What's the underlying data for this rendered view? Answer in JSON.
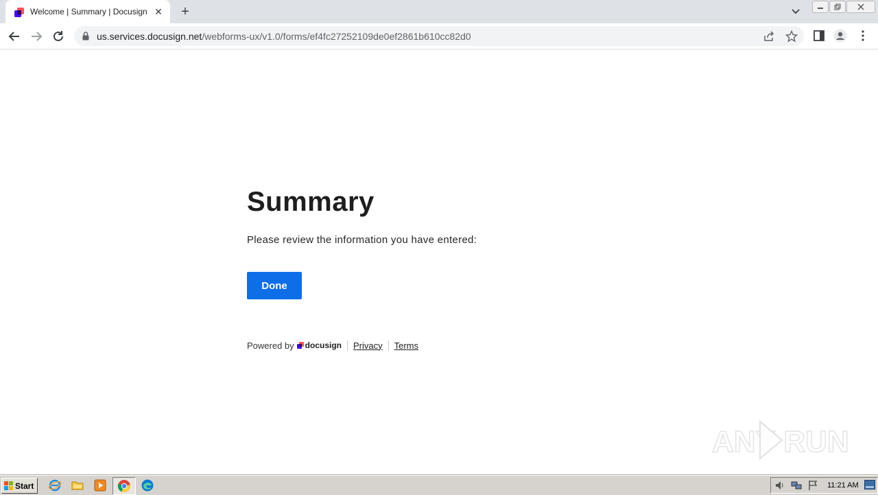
{
  "browser": {
    "tab_title": "Welcome | Summary | Docusign",
    "url_host": "us.services.docusign.net",
    "url_path": "/webforms-ux/v1.0/forms/ef4fc27252109de0ef2861b610cc82d0"
  },
  "page": {
    "title": "Summary",
    "instructions": "Please review the information you have entered:",
    "done_label": "Done",
    "footer": {
      "powered_by": "Powered by",
      "brand": "docusign",
      "privacy": "Privacy",
      "terms": "Terms"
    }
  },
  "watermark": "ANY RUN",
  "taskbar": {
    "start_label": "Start",
    "clock": "11:21 AM"
  },
  "colors": {
    "accent": "#0e6ee8",
    "brand_purple": "#4c00ff",
    "brand_pink": "#ff5252"
  }
}
